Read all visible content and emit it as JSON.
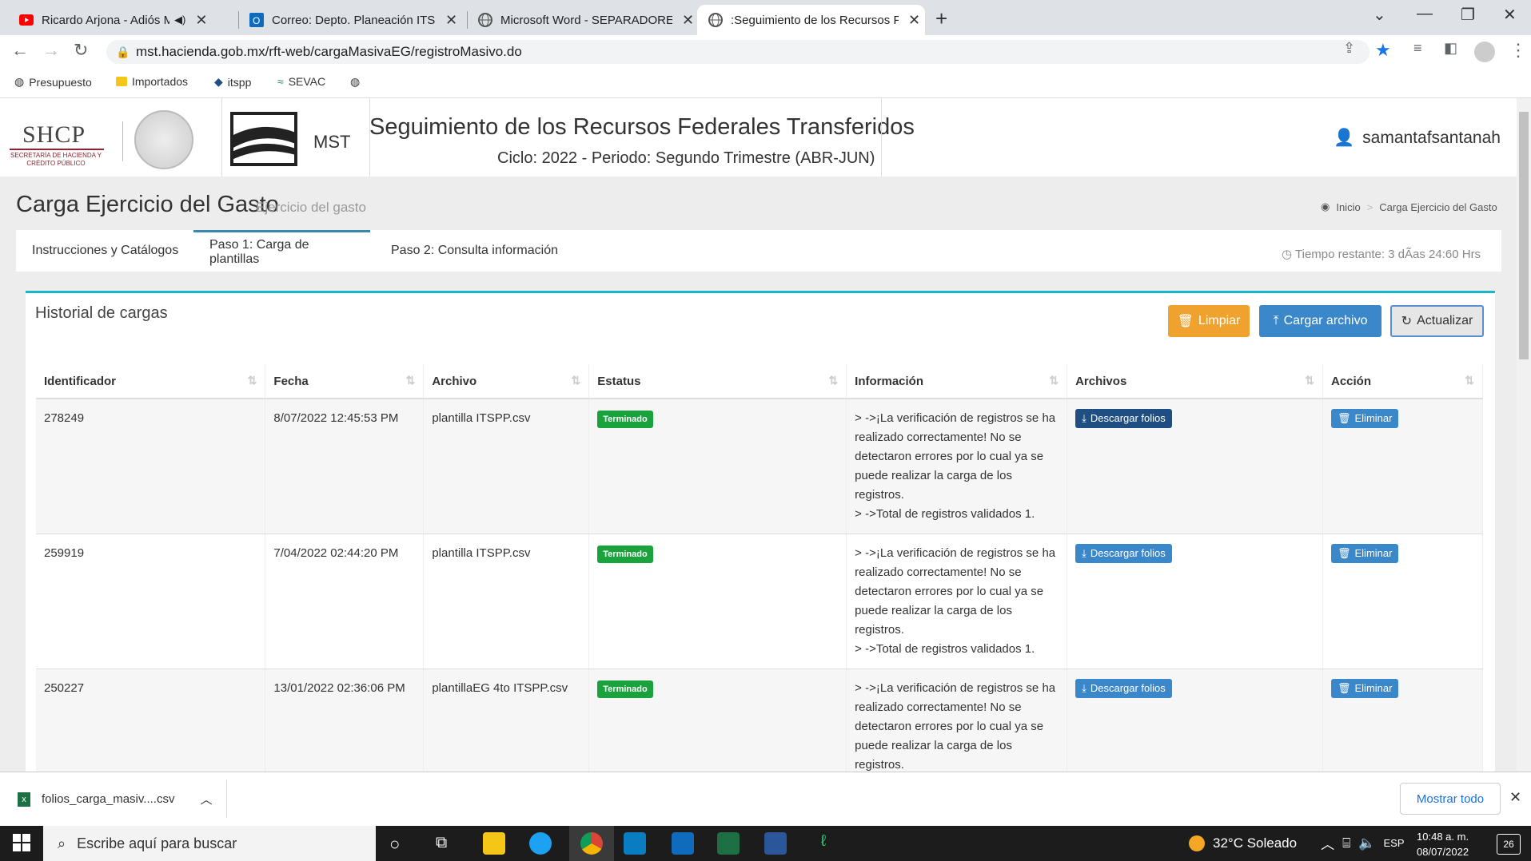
{
  "browser": {
    "tabs": [
      {
        "title": "Ricardo Arjona - Adiós Mela",
        "icon": "youtube-icon"
      },
      {
        "title": "Correo: Depto. Planeación ITSPP",
        "icon": "outlook-icon"
      },
      {
        "title": "Microsoft Word - SEPARADORES",
        "icon": "globe-icon"
      },
      {
        "title": ":Seguimiento de los Recursos Fe",
        "icon": "globe-icon"
      }
    ],
    "url": "mst.hacienda.gob.mx/rft-web/cargaMasivaEG/registroMasivo.do",
    "bookmarks": [
      "Presupuesto",
      "Importados",
      "itspp",
      "SEVAC"
    ]
  },
  "header": {
    "shcp_logo": "SHCP",
    "shcp_sub": "SECRETARÍA DE HACIENDA Y CRÉDITO PÚBLICO",
    "mst": "MST",
    "title": "Seguimiento de los Recursos Federales Transferidos",
    "subtitle": "Ciclo: 2022 - Periodo: Segundo Trimestre (ABR-JUN)",
    "user": "samantafsantanah"
  },
  "page": {
    "title": "Carga Ejercicio del Gasto",
    "title_small": "Ejercicio del gasto",
    "breadcrumb": [
      "Inicio",
      "Carga Ejercicio del Gasto"
    ],
    "tabs": [
      "Instrucciones y Catálogos",
      "Paso 1: Carga de plantillas",
      "Paso 2: Consulta información"
    ],
    "timer": "Tiempo restante: 3 dÃas 24:60 Hrs"
  },
  "panel": {
    "title": "Historial de cargas",
    "buttons": {
      "clear": "Limpiar",
      "upload": "Cargar archivo",
      "refresh": "Actualizar"
    },
    "columns": [
      "Identificador",
      "Fecha",
      "Archivo",
      "Estatus",
      "Información",
      "Archivos",
      "Acción"
    ],
    "rows": [
      {
        "id": "278249",
        "date": "8/07/2022 12:45:53 PM",
        "file": "plantilla ITSPP.csv",
        "status": "Terminado",
        "info": [
          "> ->¡La verificación de registros se ha realizado correctamente! No se detectaron errores por lo cual ya se puede realizar la carga de los registros.",
          "> ->Total de registros validados 1."
        ],
        "download": "Descargar folios",
        "action": "Eliminar"
      },
      {
        "id": "259919",
        "date": "7/04/2022 02:44:20 PM",
        "file": "plantilla ITSPP.csv",
        "status": "Terminado",
        "info": [
          "> ->¡La verificación de registros se ha realizado correctamente! No se detectaron errores por lo cual ya se puede realizar la carga de los registros.",
          "> ->Total de registros validados 1."
        ],
        "download": "Descargar folios",
        "action": "Eliminar"
      },
      {
        "id": "250227",
        "date": "13/01/2022 02:36:06 PM",
        "file": "plantillaEG 4to ITSPP.csv",
        "status": "Terminado",
        "info": [
          "> ->¡La verificación de registros se ha realizado correctamente! No se detectaron errores por lo cual ya se puede realizar la carga de los registros."
        ],
        "download": "Descargar folios",
        "action": "Eliminar"
      }
    ]
  },
  "downloads": {
    "file": "folios_carga_masiv....csv",
    "show_all": "Mostrar todo"
  },
  "taskbar": {
    "search_placeholder": "Escribe aquí para buscar",
    "weather": "32°C  Soleado",
    "lang": "ESP",
    "time": "10:48 a. m.",
    "date": "08/07/2022",
    "notifications": "26"
  },
  "colors": {
    "accent": "#1ab7c7",
    "primary_btn": "#3a87c9",
    "warning_btn": "#f0a22e",
    "success": "#1aa33d"
  }
}
